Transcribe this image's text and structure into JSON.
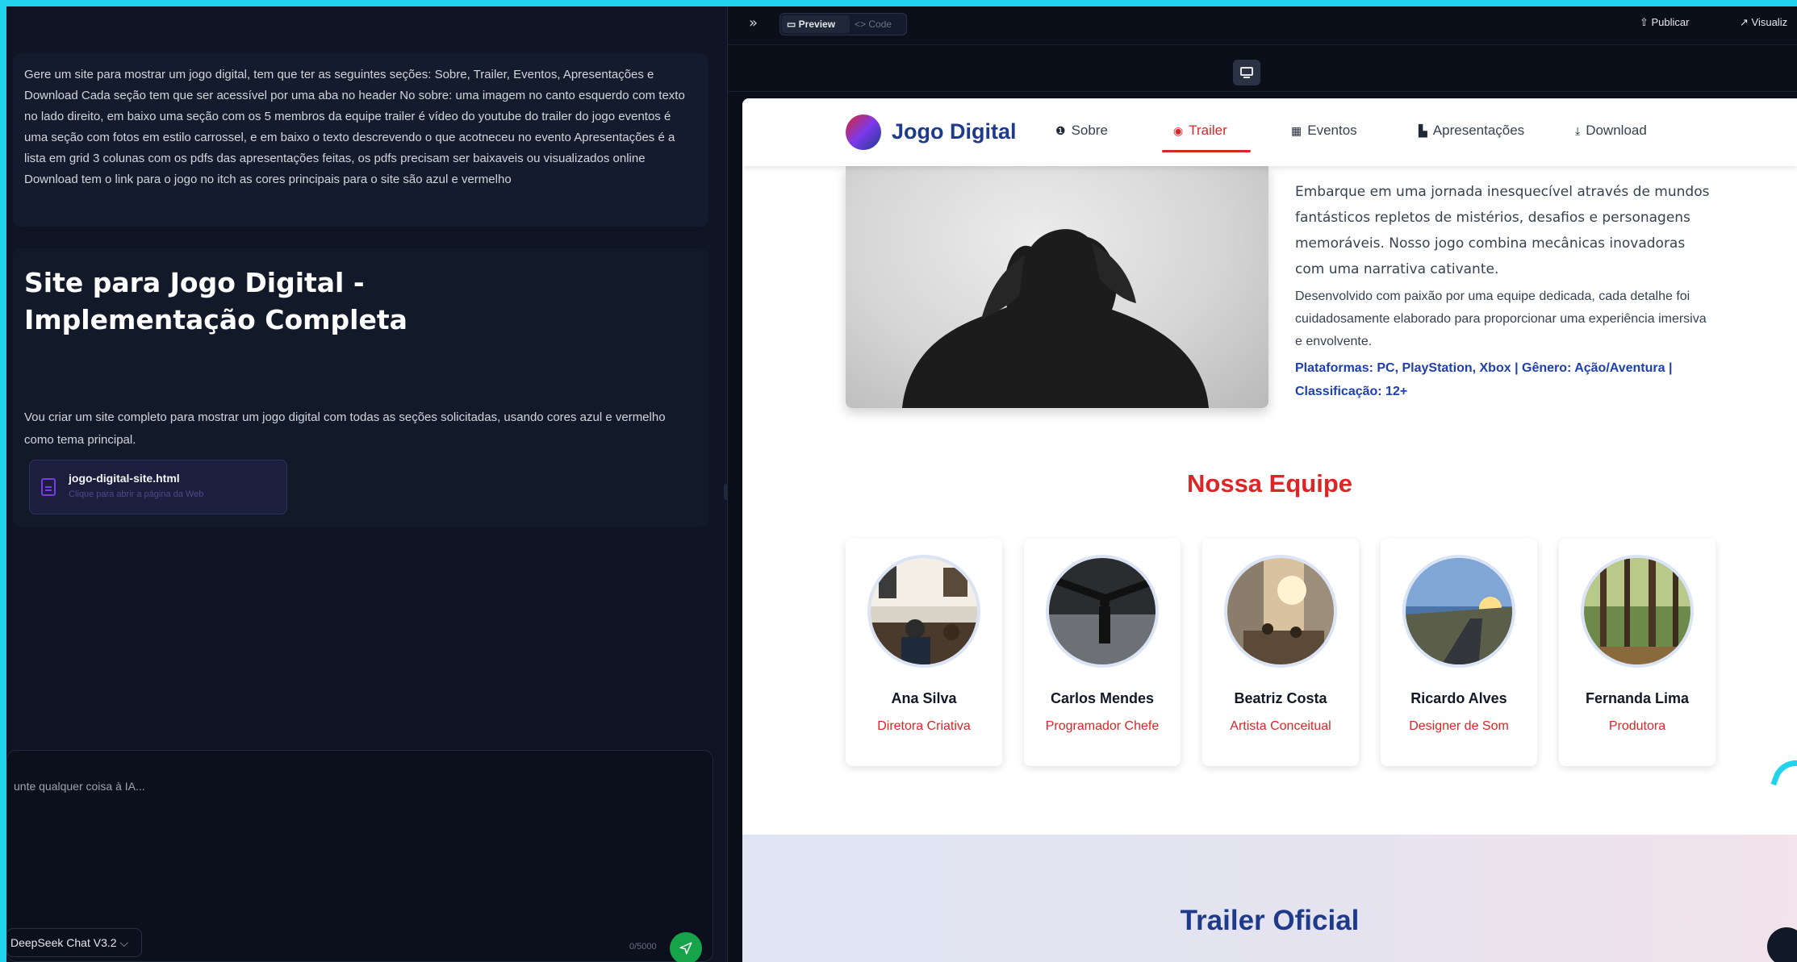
{
  "chat": {
    "prompt": "Gere um site para mostrar um jogo digital, tem que ter as seguintes seções: Sobre, Trailer, Eventos, Apresentações e Download Cada seção tem que ser acessível por uma aba no header No sobre: uma imagem no canto esquerdo com texto no lado direito, em baixo uma seção com os 5 membros da equipe trailer é vídeo do youtube do trailer do jogo eventos é uma seção com fotos em estilo carrossel, e em baixo o texto descrevendo o que acotneceu no evento Apresentações é a lista em grid 3 colunas com os pdfs das apresentações feitas, os pdfs precisam ser baixaveis ou visualizados online Download tem o link para o jogo no itch as cores principais para o site são azul e vermelho",
    "answer_title": "Site para Jogo Digital - Implementação Completa",
    "answer_body": "Vou criar um site completo para mostrar um jogo digital com todas as seções solicitadas, usando cores azul e vermelho como tema principal.",
    "file_name": "jogo-digital-site.html",
    "file_hint": "Clique para abrir a página da Web",
    "input_placeholder": "unte qualquer coisa à IA...",
    "model": "DeepSeek Chat V3.2",
    "char_count": "0/5000"
  },
  "toolbar": {
    "collapse": "»",
    "preview_tab": "Preview",
    "code_tab": "<> Code",
    "publish": "Publicar",
    "view": "Visualiz"
  },
  "site": {
    "logo_text": "Jogo Digital",
    "nav": [
      {
        "label": "Sobre",
        "icon": "info-icon"
      },
      {
        "label": "Trailer",
        "icon": "play-icon"
      },
      {
        "label": "Eventos",
        "icon": "calendar-icon"
      },
      {
        "label": "Apresentações",
        "icon": "pdf-icon"
      },
      {
        "label": "Download",
        "icon": "download-icon"
      }
    ],
    "active_nav": "Trailer",
    "about": {
      "paragraph_1": "Embarque em uma jornada inesquecível através de mundos fantásticos repletos de mistérios, desafios e personagens memoráveis. Nosso jogo combina mecânicas inovadoras com uma narrativa cativante.",
      "paragraph_2": "Desenvolvido com paixão por uma equipe dedicada, cada detalhe foi cuidadosamente elaborado para proporcionar uma experiência imersiva e envolvente.",
      "meta": "Plataformas: PC, PlayStation, Xbox | Gênero: Ação/Aventura | Classificação: 12+"
    },
    "team_title": "Nossa Equipe",
    "team": [
      {
        "name": "Ana Silva",
        "role": "Diretora Criativa"
      },
      {
        "name": "Carlos Mendes",
        "role": "Programador Chefe"
      },
      {
        "name": "Beatriz Costa",
        "role": "Artista Conceitual"
      },
      {
        "name": "Ricardo Alves",
        "role": "Designer de Som"
      },
      {
        "name": "Fernanda Lima",
        "role": "Produtora"
      }
    ],
    "trailer_title": "Trailer Oficial"
  },
  "colors": {
    "accent_red": "#dc2626",
    "accent_blue": "#1e3a8a",
    "frame_cyan": "#22d3ee"
  }
}
